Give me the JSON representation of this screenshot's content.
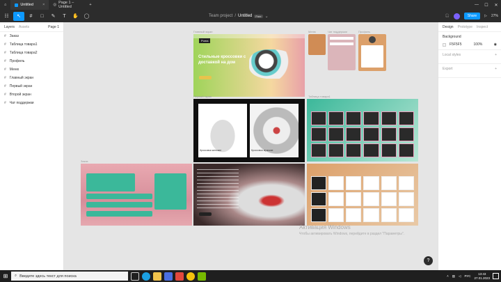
{
  "tabs": {
    "home_icon": "home-icon",
    "t1": "Untitled",
    "t2": "Page 1 – Untitled",
    "plus": "+"
  },
  "window": {
    "min": "—",
    "max": "☐",
    "close": "✕"
  },
  "toolbar": {
    "menu": "☷",
    "move": "↖",
    "frame": "#",
    "shape": "□",
    "pen": "✎",
    "text": "T",
    "hand": "✋",
    "comment": "◯"
  },
  "title": {
    "project": "Team project",
    "sep": "/",
    "file": "Untitled",
    "plan": "Free",
    "chevron": "⌄"
  },
  "topright": {
    "share": "Share",
    "zoom": "27%",
    "play": "▷"
  },
  "left": {
    "layers": "Layers",
    "assets": "Assets",
    "page": "Page 1",
    "items": [
      "Заказ",
      "Таблица товара1",
      "Таблица товара2",
      "Профиль",
      "Меню",
      "Главный экран",
      "Первый экран",
      "Второй экран",
      "Чат поддержки"
    ]
  },
  "right": {
    "tabs": [
      "Design",
      "Prototype",
      "Inspect"
    ],
    "background": "Background",
    "bg_hex": "F5F5F5",
    "bg_pct": "100%",
    "local": "Local styles",
    "export": "Export",
    "plus": "+"
  },
  "frames": {
    "l_main": "Главный экран",
    "l_menu": "Меню",
    "l_chat": "Чат поддержки",
    "l_profile": "Профиль",
    "l_first": "Первый экран",
    "l_table": "Таблица товара1",
    "l_order": "Заказ",
    "hero": "Стильные кроссовки с доставкой на дом",
    "hero_tag": "Puma",
    "cap1": "Кроссовки женские",
    "cap2": "Кроссовки мужские"
  },
  "activation": {
    "line1": "Активация Windows",
    "line2": "Чтобы активировать Windows, перейдите в раздел \"Параметры\"."
  },
  "help": "?",
  "taskbar": {
    "search": "Введите здесь текст для поиска",
    "lang": "РУС",
    "time": "13:43",
    "date": "27.01.2023"
  }
}
